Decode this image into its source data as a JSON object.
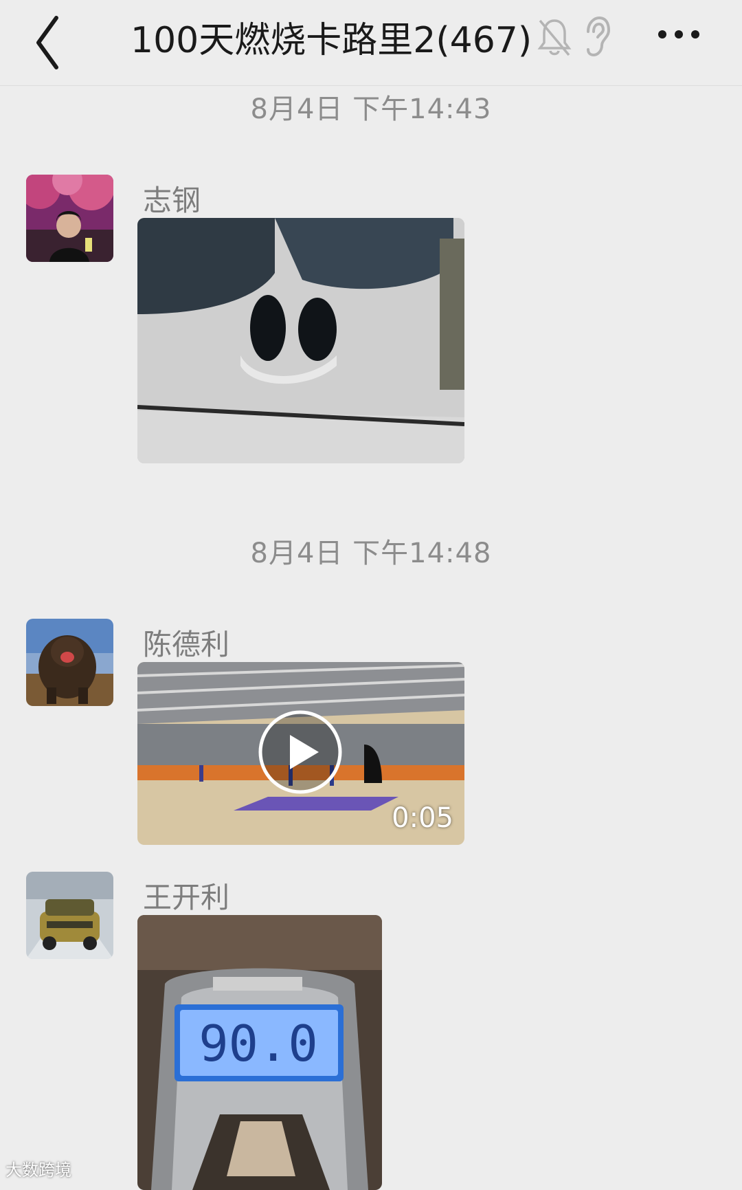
{
  "header": {
    "title": "100天燃烧卡路里2(467)",
    "back_icon": "chevron-left-icon",
    "mute_icon": "bell-muted-icon",
    "earpiece_icon": "ear-icon",
    "more_icon": "more-dots-icon"
  },
  "messages": [
    {
      "timestamp": "8月4日 下午14:43",
      "sender": "志钢",
      "type": "image"
    },
    {
      "timestamp": "8月4日 下午14:48",
      "sender": "陈德利",
      "type": "video",
      "duration": "0:05"
    },
    {
      "sender": "王开利",
      "type": "image",
      "scale_display": "90.0"
    }
  ],
  "watermark": "大数跨境"
}
